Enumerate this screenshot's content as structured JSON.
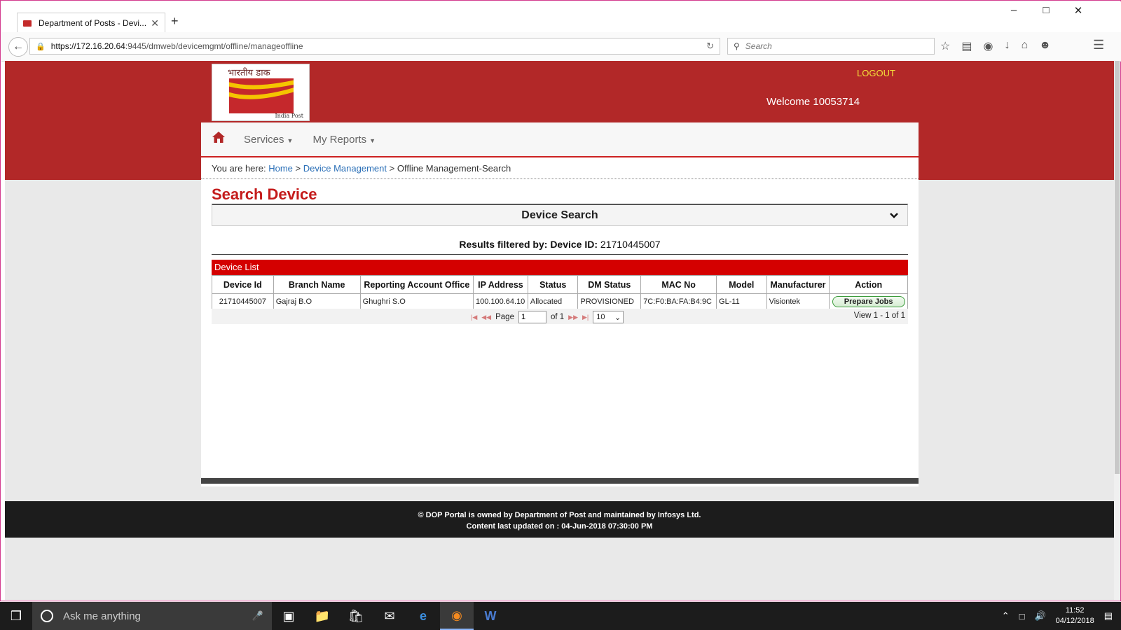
{
  "browser": {
    "tab_title": "Department of Posts - Devi...",
    "url_host": "https://172.16.20.64",
    "url_rest": ":9445/dmweb/devicemgmt/offline/manageoffline",
    "search_placeholder": "Search"
  },
  "header": {
    "logo_hindi": "भारतीय डाक",
    "logo_english": "India Post",
    "logout": "LOGOUT",
    "welcome": "Welcome 10053714"
  },
  "menu": {
    "services": "Services",
    "reports": "My Reports"
  },
  "breadcrumb": {
    "prefix": "You are here:",
    "home": "Home",
    "device_mgmt": "Device Management",
    "current": "Offline Management-Search",
    "sep": ">"
  },
  "page": {
    "title": "Search Device",
    "search_panel": "Device Search",
    "filter_label": "Results filtered by: Device ID:",
    "filter_value": "21710445007",
    "list_title": "Device List"
  },
  "table": {
    "headers": [
      "Device Id",
      "Branch Name",
      "Reporting Account Office",
      "IP Address",
      "Status",
      "DM Status",
      "MAC No",
      "Model",
      "Manufacturer",
      "Action"
    ],
    "rows": [
      [
        "21710445007",
        "Gajraj B.O",
        "Ghughri S.O",
        "100.100.64.10",
        "Allocated",
        "PROVISIONED",
        "7C:F0:BA:FA:B4:9C",
        "GL-11",
        "Visiontek",
        "Prepare Jobs"
      ]
    ]
  },
  "pager": {
    "page_label": "Page",
    "page_value": "1",
    "of_label": "of 1",
    "page_size": "10",
    "view": "View 1 - 1 of 1"
  },
  "footer": {
    "line1": "© DOP Portal is owned by Department of Post and maintained by Infosys Ltd.",
    "line2": "Content last updated on : 04-Jun-2018 07:30:00 PM"
  },
  "taskbar": {
    "cortana": "Ask me anything",
    "time": "11:52",
    "date": "04/12/2018"
  },
  "colors": {
    "brand_red": "#b22828",
    "title_red": "#c41b1b",
    "logout_yellow": "#f5e13a",
    "link_blue": "#2a6fb7"
  }
}
